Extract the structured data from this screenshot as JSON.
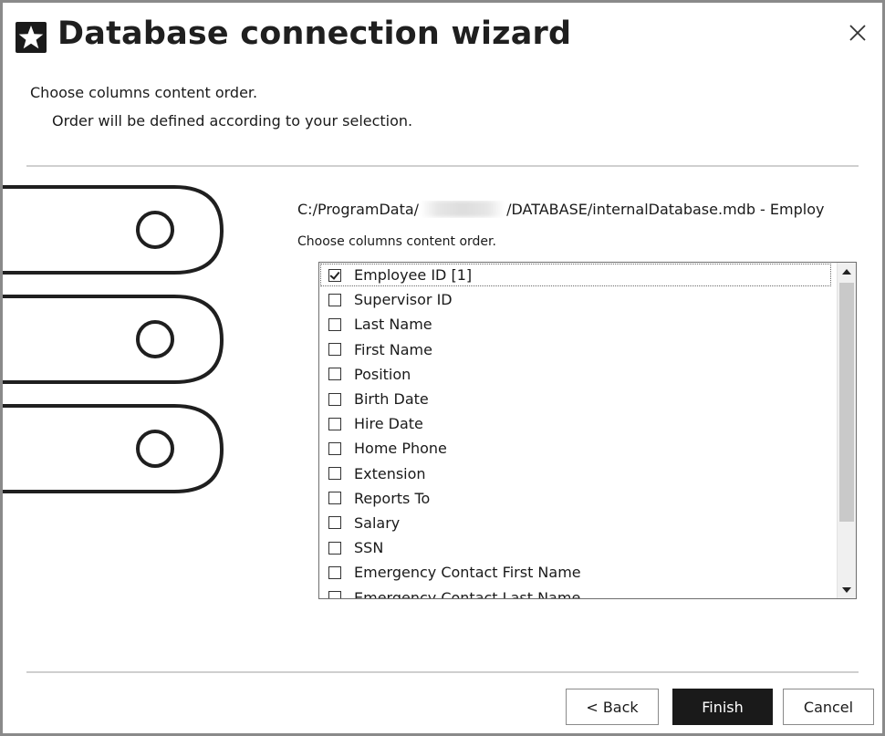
{
  "window": {
    "title": "Database connection wizard",
    "icon": "star-icon",
    "close_icon": "close-icon"
  },
  "header": {
    "subtitle": "Choose columns content order.",
    "description": "Order will be defined according to your selection."
  },
  "source": {
    "path_prefix": "C:/ProgramData/",
    "path_suffix": "/DATABASE/internalDatabase.mdb - Employ"
  },
  "columns": {
    "caption": "Choose columns content order.",
    "items": [
      {
        "label": "Employee ID [1]",
        "checked": true
      },
      {
        "label": "Supervisor ID",
        "checked": false
      },
      {
        "label": "Last Name",
        "checked": false
      },
      {
        "label": "First Name",
        "checked": false
      },
      {
        "label": "Position",
        "checked": false
      },
      {
        "label": "Birth Date",
        "checked": false
      },
      {
        "label": "Hire Date",
        "checked": false
      },
      {
        "label": "Home Phone",
        "checked": false
      },
      {
        "label": "Extension",
        "checked": false
      },
      {
        "label": "Reports To",
        "checked": false
      },
      {
        "label": "Salary",
        "checked": false
      },
      {
        "label": "SSN",
        "checked": false
      },
      {
        "label": "Emergency Contact First Name",
        "checked": false
      },
      {
        "label": "Emergency Contact Last Name",
        "checked": false
      }
    ]
  },
  "buttons": {
    "back": "< Back",
    "finish": "Finish",
    "cancel": "Cancel"
  },
  "colors": {
    "primary_button": "#1a1a1a",
    "border": "#8a8a8a"
  }
}
